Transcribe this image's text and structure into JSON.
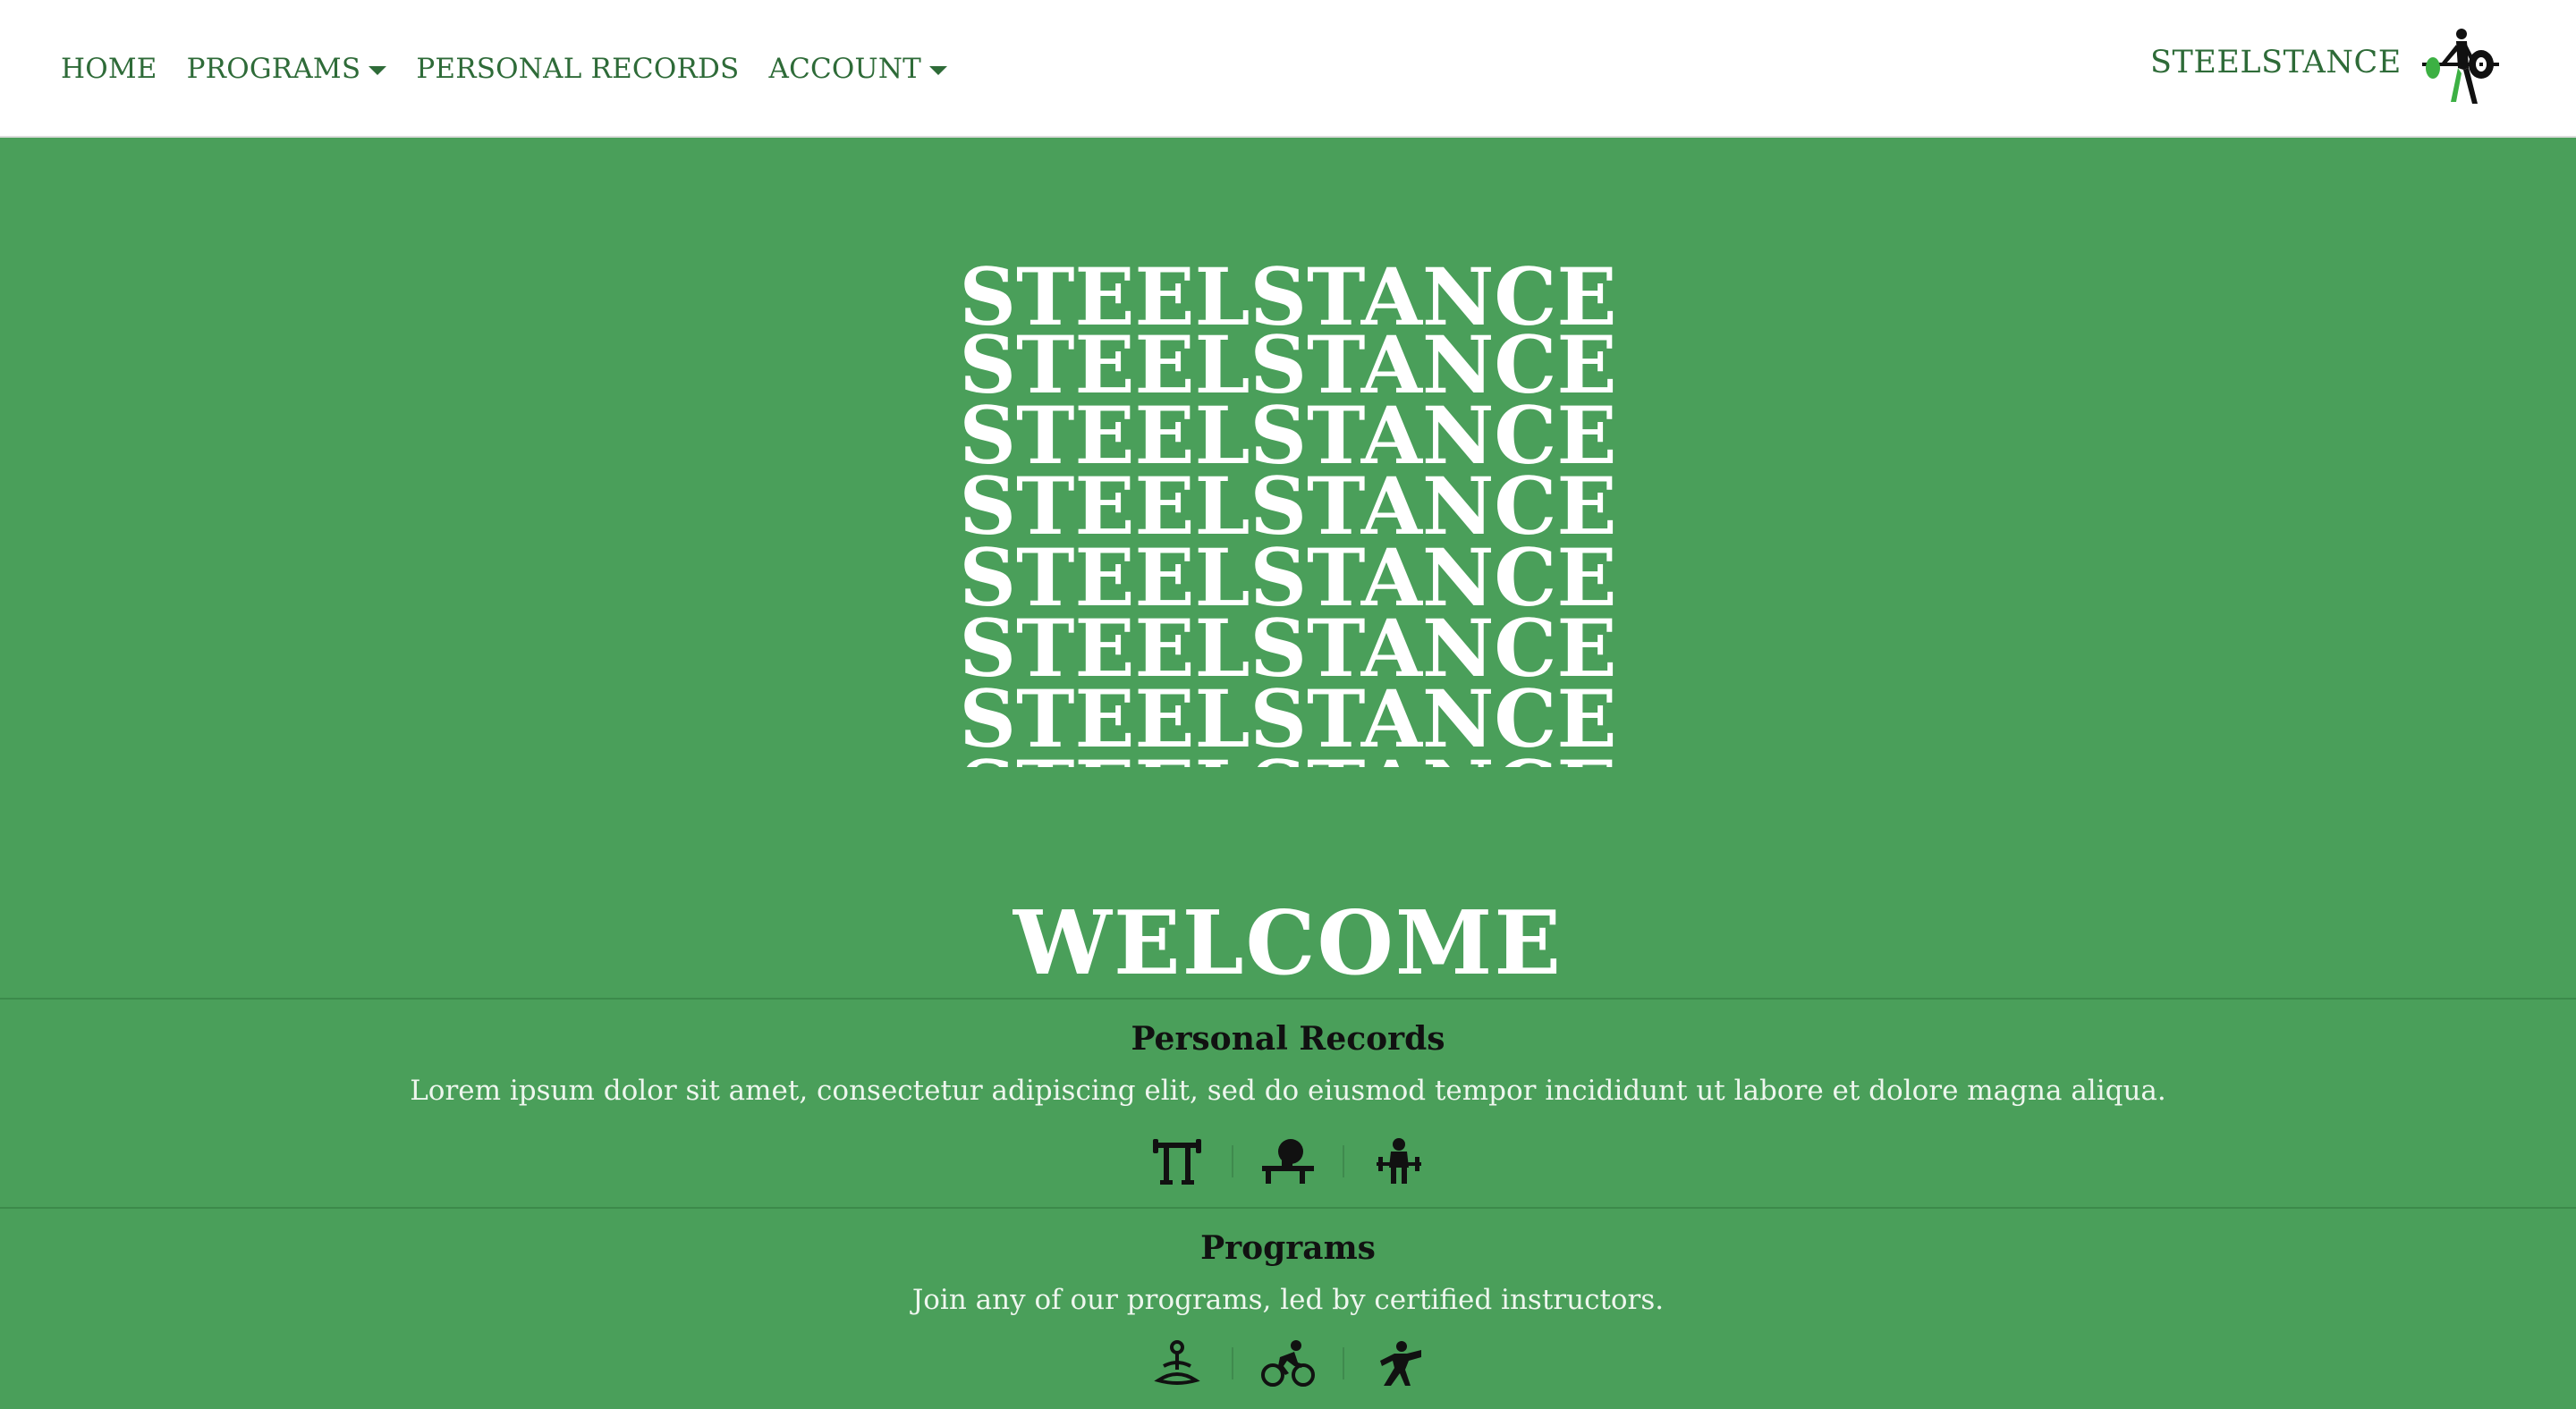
{
  "nav": {
    "items": [
      {
        "label": "HOME",
        "dropdown": false
      },
      {
        "label": "PROGRAMS",
        "dropdown": true
      },
      {
        "label": "PERSONAL RECORDS",
        "dropdown": false
      },
      {
        "label": "ACCOUNT",
        "dropdown": true
      }
    ],
    "brand": "STEELSTANCE",
    "logo_icon": "weightlifter-logo-icon"
  },
  "hero": {
    "repeat_text": "STEELSTANCE",
    "welcome": "WELCOME"
  },
  "sections": [
    {
      "title": "Personal Records",
      "description": "Lorem ipsum dolor sit amet, consectetur adipiscing elit, sed do eiusmod tempor incididunt ut labore et dolore magna aliqua.",
      "icons": [
        "squat-rack-icon",
        "bench-press-icon",
        "deadlift-icon"
      ]
    },
    {
      "title": "Programs",
      "description": "Join any of our programs, led by certified instructors.",
      "icons": [
        "yoga-icon",
        "cycling-icon",
        "boxing-icon"
      ]
    }
  ],
  "colors": {
    "background": "#4a9f5a",
    "nav_text": "#2e6b38",
    "logo_accent": "#3cb043"
  }
}
